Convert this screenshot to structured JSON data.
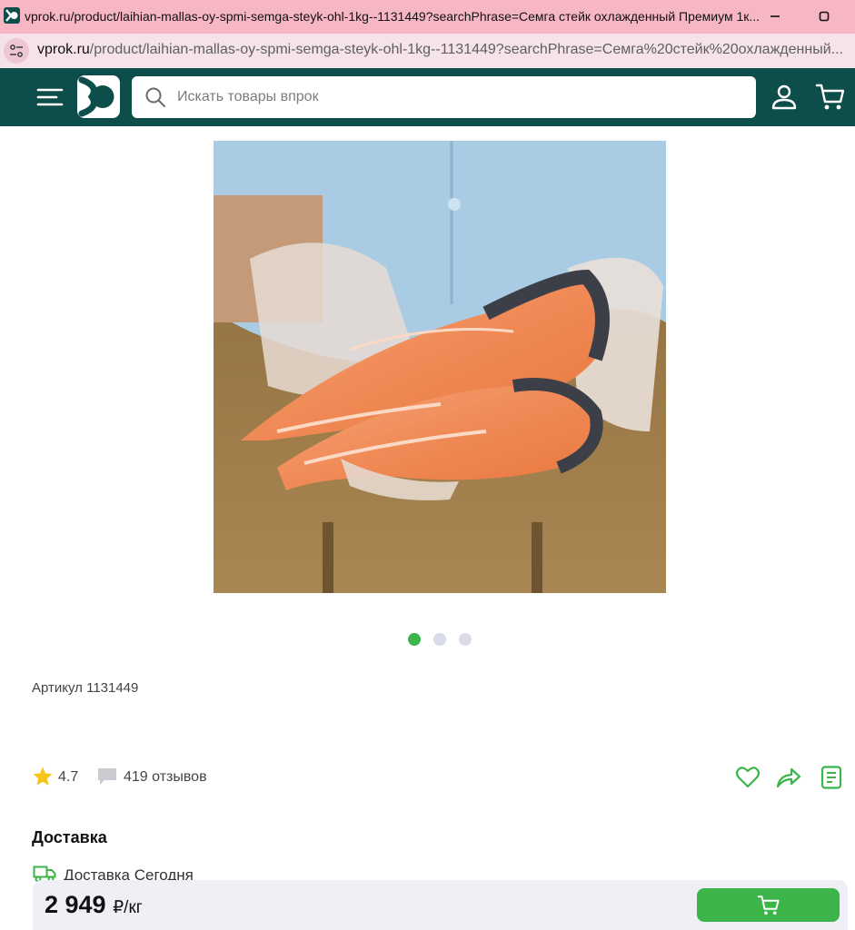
{
  "browser": {
    "tab_title": "vprok.ru/product/laihian-mallas-oy-spmi-semga-steyk-ohl-1kg--1131449?searchPhrase=Семга стейк охлажденный Премиум 1к...",
    "url_host": "vprok.ru",
    "url_path": "/product/laihian-mallas-oy-spmi-semga-steyk-ohl-1kg--1131449?searchPhrase=Семга%20стейк%20охлажденный..."
  },
  "header": {
    "search_placeholder": "Искать товары впрок",
    "colors": {
      "background": "#0d4e4b",
      "accent": "#3bb54a"
    }
  },
  "gallery": {
    "images_count": 3,
    "active_index": 0
  },
  "product": {
    "article": "Артикул 1131449",
    "rating": "4.7",
    "reviews": "419 отзывов"
  },
  "delivery": {
    "heading": "Доставка",
    "option": "Доставка Сегодня"
  },
  "purchase": {
    "price": "2 949",
    "unit": "₽/кг"
  },
  "icons": [
    "menu-icon",
    "logo",
    "search-icon",
    "user-icon",
    "cart-icon",
    "star-icon",
    "comment-icon",
    "heart-icon",
    "share-icon",
    "notes-icon",
    "truck-icon"
  ]
}
